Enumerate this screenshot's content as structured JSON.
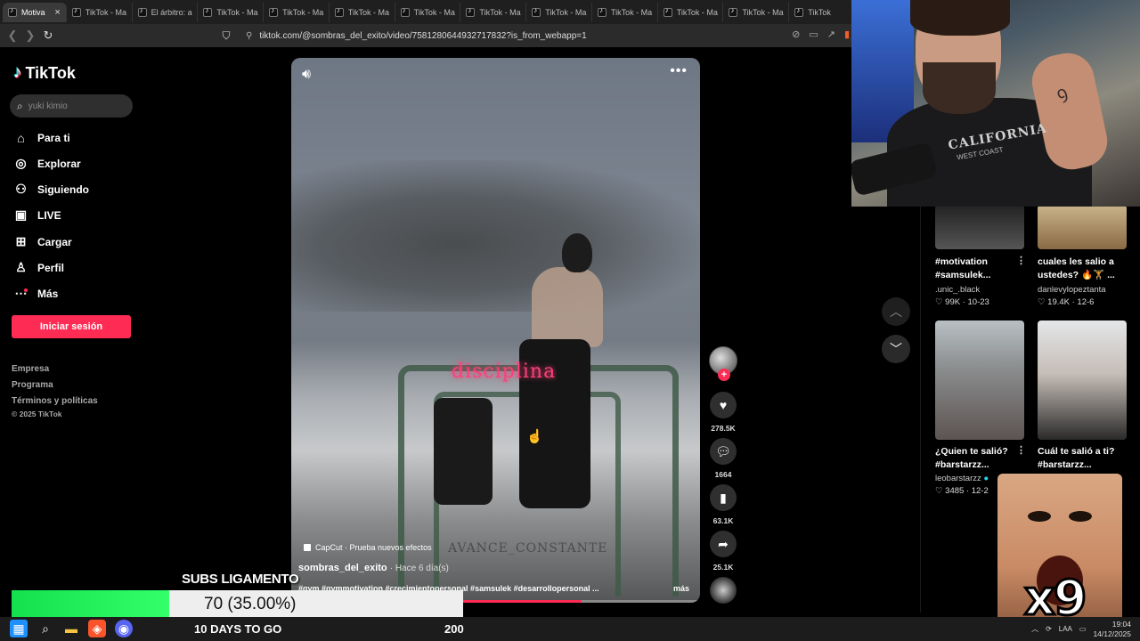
{
  "browser": {
    "tabs": [
      {
        "label": "Motiva",
        "active": true
      },
      {
        "label": "TikTok - Ma"
      },
      {
        "label": "El árbitro: a"
      },
      {
        "label": "TikTok - Ma"
      },
      {
        "label": "TikTok - Ma"
      },
      {
        "label": "TikTok - Ma"
      },
      {
        "label": "TikTok - Ma"
      },
      {
        "label": "TikTok - Ma"
      },
      {
        "label": "TikTok - Ma"
      },
      {
        "label": "TikTok - Ma"
      },
      {
        "label": "TikTok - Ma"
      },
      {
        "label": "TikTok - Ma"
      },
      {
        "label": "TikTok"
      }
    ],
    "url": "tiktok.com/@sombras_del_exito/video/7581280644932717832?is_from_webapp=1"
  },
  "sidebar": {
    "brand": "TikTok",
    "search_placeholder": "yuki kimio",
    "nav": [
      {
        "label": "Para ti",
        "icon": "home-icon"
      },
      {
        "label": "Explorar",
        "icon": "compass-icon"
      },
      {
        "label": "Siguiendo",
        "icon": "following-icon"
      },
      {
        "label": "LIVE",
        "icon": "live-icon"
      },
      {
        "label": "Cargar",
        "icon": "upload-icon"
      },
      {
        "label": "Perfil",
        "icon": "profile-icon"
      },
      {
        "label": "Más",
        "icon": "more-icon"
      }
    ],
    "login_label": "Iniciar sesión",
    "footer": [
      "Empresa",
      "Programa",
      "Términos y políticas"
    ],
    "copyright": "© 2025 TikTok"
  },
  "video": {
    "overlay_word": "disciplina",
    "watermark": "AVANCE_CONSTANTE",
    "capcut_label": "CapCut · Prueba nuevos efectos",
    "author": "sombras_del_exito",
    "posted": "· Hace 6 día(s)",
    "hashtags": "#gym #gymmotivation #crecimientopersonal #samsulek #desarrollopersonal ...",
    "more_label": "más",
    "progress": 0.71
  },
  "actions": {
    "likes": "278.5K",
    "comments": "1664",
    "saves": "63.1K",
    "shares": "25.1K"
  },
  "recommendations": [
    {
      "title_lines": [
        "#motivation",
        "#samsulek..."
      ],
      "user": ".unic_.black",
      "stats": "♡ 99K · 10-23"
    },
    {
      "title_lines": [
        "cuales les salio a",
        "ustedes? 🔥🏋 ..."
      ],
      "user": "danlevylopeztanta",
      "stats": "♡ 19.4K · 12-6"
    },
    {
      "title_lines": [
        "¿Quien te salió?",
        "#barstarzz..."
      ],
      "user": "leobarstarzz",
      "stats": "♡ 3485 · 12-2"
    },
    {
      "title_lines": [
        "Cuál te salió a ti?",
        "#barstarzz..."
      ],
      "user": "",
      "stats": ""
    }
  ],
  "webcam": {
    "shirt_text": "CALIFORNIA",
    "shirt_sub": "WEST COAST"
  },
  "reaction": {
    "badge": "x9"
  },
  "stream": {
    "subs_label": "SUBS LIGAMENTO",
    "subs_percent_text": "70 (35.00%)",
    "subs_fraction": 0.35,
    "goal_text": "10 DAYS TO GO",
    "goal_num": "200"
  },
  "taskbar": {
    "lang": "LAA",
    "time": "19:04",
    "date": "14/12/2025"
  }
}
